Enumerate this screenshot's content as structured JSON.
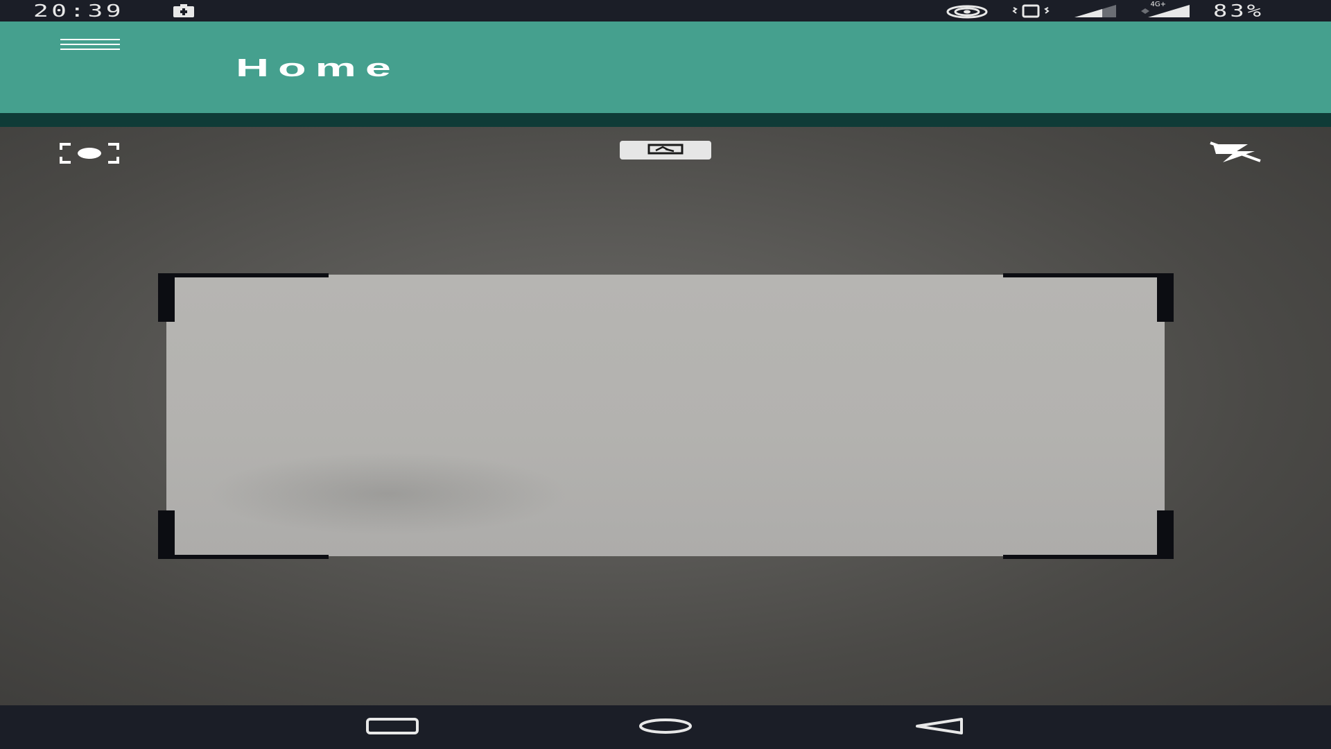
{
  "status_bar": {
    "time": "20:39",
    "battery_percent": "83%",
    "network_label": "4G+",
    "icons": [
      "battery-saver-icon",
      "hotspot-icon",
      "vibrate-icon",
      "signal-icon",
      "signal-4g-icon"
    ]
  },
  "app_bar": {
    "title": "Home",
    "menu_icon": "hamburger-menu-icon",
    "background_color": "#45a08e"
  },
  "camera_controls": {
    "focus_icon": "focus-icon",
    "switch_camera_icon": "switch-camera-icon",
    "flash_icon": "flash-off-icon"
  },
  "navigation_bar": {
    "icons": [
      "recents-icon",
      "home-icon",
      "back-icon"
    ]
  }
}
